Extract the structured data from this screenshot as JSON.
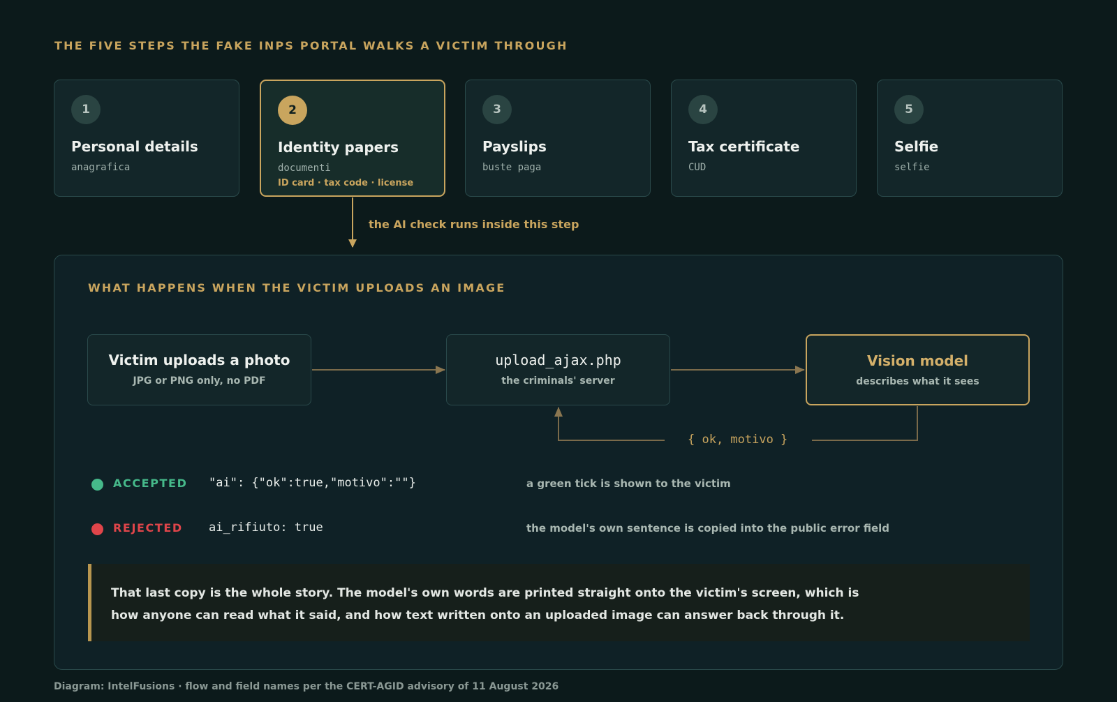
{
  "heading": "THE FIVE STEPS THE FAKE INPS PORTAL WALKS A VICTIM THROUGH",
  "steps": [
    {
      "number": "1",
      "title": "Personal details",
      "italian": "anagrafica",
      "extra": ""
    },
    {
      "number": "2",
      "title": "Identity papers",
      "italian": "documenti",
      "extra": "ID card · tax code · license"
    },
    {
      "number": "3",
      "title": "Payslips",
      "italian": "buste paga",
      "extra": ""
    },
    {
      "number": "4",
      "title": "Tax certificate",
      "italian": "CUD",
      "extra": ""
    },
    {
      "number": "5",
      "title": "Selfie",
      "italian": "selfie",
      "extra": ""
    }
  ],
  "step_note": "the AI check runs inside this step",
  "panel": {
    "heading": "WHAT HAPPENS WHEN THE VICTIM UPLOADS AN IMAGE",
    "flow": [
      {
        "title": "Victim uploads a photo",
        "sub": "JPG or PNG only, no PDF"
      },
      {
        "title": "upload_ajax.php",
        "sub": "the criminals' server"
      },
      {
        "title": "Vision model",
        "sub": "describes what it sees"
      }
    ],
    "return_label": "{ ok, motivo }",
    "results": [
      {
        "label": "ACCEPTED",
        "code": "\"ai\": {\"ok\":true,\"motivo\":\"\"}",
        "description": "a green tick is shown to the victim",
        "color": "#46b98a"
      },
      {
        "label": "REJECTED",
        "code": "ai_rifiuto: true",
        "description": "the model's own sentence is copied into the public error field",
        "color": "#e0454a"
      }
    ],
    "callout": {
      "line1": "That last copy is the whole story. The model's own words are printed straight onto the victim's screen, which is",
      "line2": "how anyone can read what it said, and how text written onto an uploaded image can answer back through it."
    }
  },
  "footer": "Diagram: IntelFusions · flow and field names per the CERT-AGID advisory of 11 August 2026",
  "colors": {
    "accent": "#c9a55e",
    "background": "#0c1a1b",
    "accepted": "#46b98a",
    "rejected": "#e0454a"
  }
}
